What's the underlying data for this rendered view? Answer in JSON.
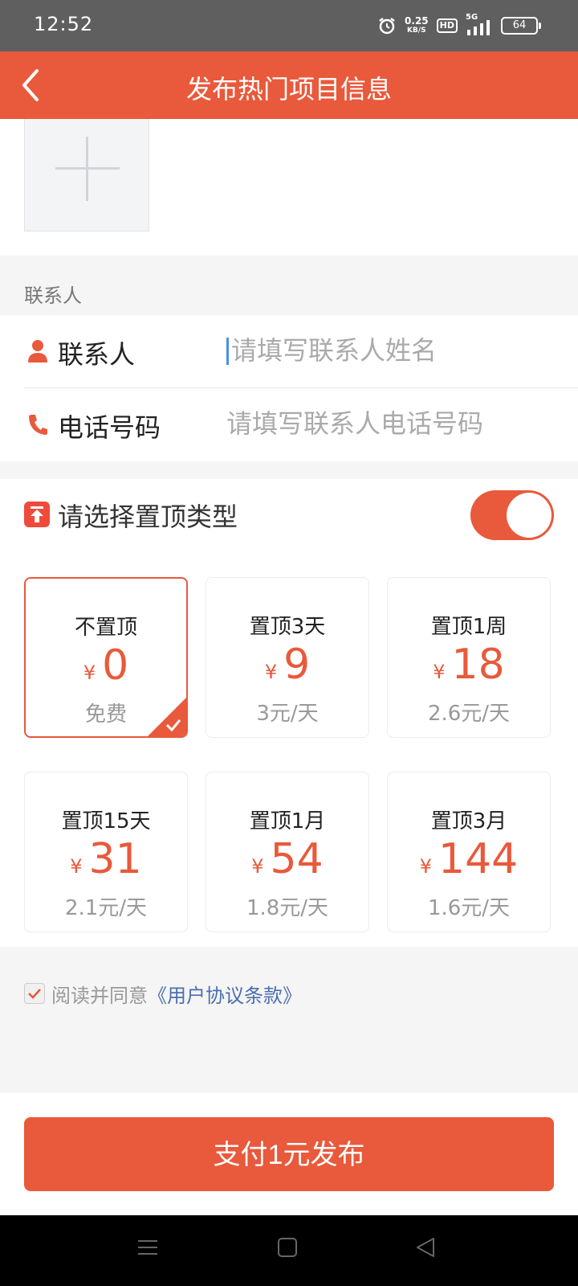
{
  "status_bar": {
    "time": "12:52",
    "net_speed_value": "0.25",
    "net_speed_unit": "KB/S",
    "hd": "HD",
    "signal": "5G",
    "battery": "64"
  },
  "nav": {
    "title": "发布热门项目信息",
    "back_icon": "chevron-left-icon"
  },
  "upload": {
    "icon": "plus-icon"
  },
  "contact_section": {
    "label": "联系人",
    "name_row": {
      "label": "联系人",
      "placeholder": "请填写联系人姓名",
      "icon": "person-icon"
    },
    "phone_row": {
      "label": "电话号码",
      "placeholder": "请填写联系人电话号码",
      "icon": "phone-icon"
    }
  },
  "top_type": {
    "label": "请选择置顶类型",
    "icon": "pin-top-icon",
    "toggle_on": true,
    "currency": "¥",
    "options": [
      {
        "name": "不置顶",
        "price": "0",
        "note": "免费",
        "selected": true
      },
      {
        "name": "置顶3天",
        "price": "9",
        "note": "3元/天",
        "selected": false
      },
      {
        "name": "置顶1周",
        "price": "18",
        "note": "2.6元/天",
        "selected": false
      },
      {
        "name": "置顶15天",
        "price": "31",
        "note": "2.1元/天",
        "selected": false
      },
      {
        "name": "置顶1月",
        "price": "54",
        "note": "1.8元/天",
        "selected": false
      },
      {
        "name": "置顶3月",
        "price": "144",
        "note": "1.6元/天",
        "selected": false
      }
    ]
  },
  "agreement": {
    "checked": true,
    "text": "阅读并同意",
    "link": "《用户协议条款》"
  },
  "pay_button": {
    "label": "支付1元发布"
  },
  "colors": {
    "accent": "#e9593b",
    "link": "#4a6fb0"
  }
}
